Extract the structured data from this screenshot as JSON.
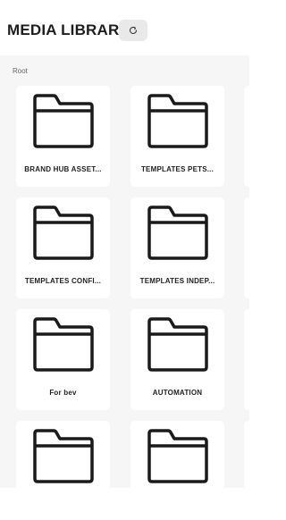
{
  "header": {
    "title": "MEDIA LIBRARY",
    "refresh_icon": "refresh-icon"
  },
  "breadcrumb": "Root",
  "folders": [
    {
      "label": "BRAND HUB ASSET...",
      "icon": "folder-icon"
    },
    {
      "label": "TEMPLATES PETS...",
      "icon": "folder-icon"
    },
    {
      "label": "TEMPLATES CONFI...",
      "icon": "folder-icon"
    },
    {
      "label": "TEMPLATES INDEP...",
      "icon": "folder-icon"
    },
    {
      "label": "For bev",
      "icon": "folder-icon"
    },
    {
      "label": "AUTOMATION",
      "icon": "folder-icon"
    },
    {
      "label": "",
      "icon": "folder-icon"
    },
    {
      "label": "",
      "icon": "folder-icon"
    }
  ],
  "colors": {
    "content_bg": "#f6f6f6",
    "card_bg": "#ffffff",
    "refresh_button_bg": "#e9e9e9",
    "text": "#1e1e1e"
  }
}
